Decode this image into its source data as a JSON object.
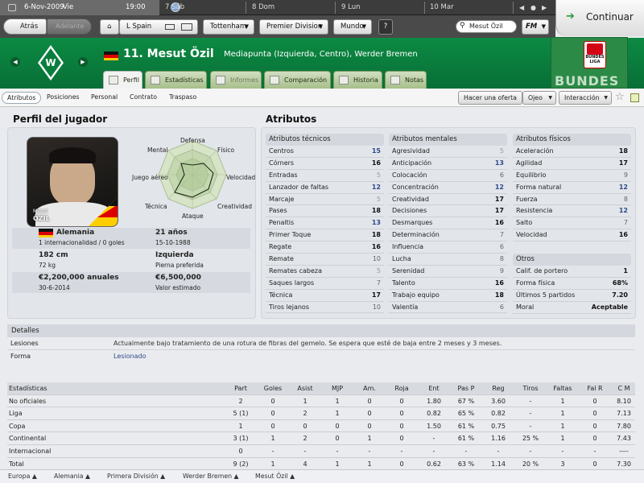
{
  "datebar": {
    "current": "6-Nov-2009",
    "current_day": "Vie",
    "time": "19:00",
    "days": [
      {
        "num": "7",
        "name": "Sáb"
      },
      {
        "num": "8",
        "name": "Dom"
      },
      {
        "num": "9",
        "name": "Lun"
      },
      {
        "num": "10",
        "name": "Mar"
      }
    ]
  },
  "toolbar": {
    "back": "Atrás",
    "forward": "Adelante",
    "nation": "L Spain",
    "club": "Tottenham",
    "league": "Premier Division",
    "world": "Mundo",
    "help": "?",
    "search_value": "Mesut Özil",
    "fm": "FM",
    "continue": "Continuar"
  },
  "player": {
    "number_name": "11. Mesut Özil",
    "position_club": "Mediapunta (Izquierda, Centro), Werder Bremen",
    "league_badge": "BUNDES LIGA",
    "league_banner": "BUNDES"
  },
  "tabs": [
    "Perfil",
    "Estadísticas",
    "Informes",
    "Comparación",
    "Historia",
    "Notas"
  ],
  "subtabs": [
    "Atributos",
    "Posiciones",
    "Personal",
    "Contrato",
    "Traspaso"
  ],
  "actions": {
    "offer": "Hacer una oferta",
    "scout": "Ojeo",
    "interaction": "Interacción"
  },
  "profile": {
    "title": "Perfil del jugador",
    "photo_name_top": "Mesut",
    "photo_name": "ÖZIL",
    "radar_labels": [
      "Defensa",
      "Físico",
      "Velocidad",
      "Creatividad",
      "Ataque",
      "Técnica",
      "Juego aéreo",
      "Mental"
    ],
    "nationality": "Alemania",
    "caps": "1 internacionalidad / 0 goles",
    "age": "21 años",
    "dob": "15-10-1988",
    "height": "182 cm",
    "weight": "72 kg",
    "foot": "Izquierda",
    "foot_label": "Pierna preferida",
    "wage": "€2,200,000 anuales",
    "contract_end": "30-6-2014",
    "value": "€6,500,000",
    "value_label": "Valor estimado"
  },
  "attributes": {
    "title": "Atributos",
    "technical": {
      "title": "Atributos técnicos",
      "rows": [
        {
          "name": "Centros",
          "value": "15",
          "tier": "good"
        },
        {
          "name": "Córners",
          "value": "16",
          "tier": "hi"
        },
        {
          "name": "Entradas",
          "value": "5",
          "tier": "lo"
        },
        {
          "name": "Lanzador de faltas",
          "value": "12",
          "tier": "good"
        },
        {
          "name": "Marcaje",
          "value": "5",
          "tier": "lo"
        },
        {
          "name": "Pases",
          "value": "18",
          "tier": "hi"
        },
        {
          "name": "Penaltis",
          "value": "13",
          "tier": "good"
        },
        {
          "name": "Primer Toque",
          "value": "18",
          "tier": "hi"
        },
        {
          "name": "Regate",
          "value": "16",
          "tier": "hi"
        },
        {
          "name": "Remate",
          "value": "10",
          "tier": "mid"
        },
        {
          "name": "Remates cabeza",
          "value": "5",
          "tier": "lo"
        },
        {
          "name": "Saques largos",
          "value": "7",
          "tier": "mid"
        },
        {
          "name": "Técnica",
          "value": "17",
          "tier": "hi"
        },
        {
          "name": "Tiros lejanos",
          "value": "10",
          "tier": "mid"
        }
      ]
    },
    "mental": {
      "title": "Atributos mentales",
      "rows": [
        {
          "name": "Agresividad",
          "value": "5",
          "tier": "lo"
        },
        {
          "name": "Anticipación",
          "value": "13",
          "tier": "good"
        },
        {
          "name": "Colocación",
          "value": "6",
          "tier": "mid"
        },
        {
          "name": "Concentración",
          "value": "12",
          "tier": "good"
        },
        {
          "name": "Creatividad",
          "value": "17",
          "tier": "hi"
        },
        {
          "name": "Decisiones",
          "value": "17",
          "tier": "hi"
        },
        {
          "name": "Desmarques",
          "value": "16",
          "tier": "hi"
        },
        {
          "name": "Determinación",
          "value": "7",
          "tier": "mid"
        },
        {
          "name": "Influencia",
          "value": "6",
          "tier": "mid"
        },
        {
          "name": "Lucha",
          "value": "8",
          "tier": "mid"
        },
        {
          "name": "Serenidad",
          "value": "9",
          "tier": "mid"
        },
        {
          "name": "Talento",
          "value": "16",
          "tier": "hi"
        },
        {
          "name": "Trabajo equipo",
          "value": "18",
          "tier": "hi"
        },
        {
          "name": "Valentía",
          "value": "6",
          "tier": "mid"
        }
      ]
    },
    "physical": {
      "title": "Atributos físicos",
      "rows": [
        {
          "name": "Aceleración",
          "value": "18",
          "tier": "hi"
        },
        {
          "name": "Agilidad",
          "value": "17",
          "tier": "hi"
        },
        {
          "name": "Equilibrio",
          "value": "9",
          "tier": "mid"
        },
        {
          "name": "Forma natural",
          "value": "12",
          "tier": "good"
        },
        {
          "name": "Fuerza",
          "value": "8",
          "tier": "mid"
        },
        {
          "name": "Resistencia",
          "value": "12",
          "tier": "good"
        },
        {
          "name": "Salto",
          "value": "7",
          "tier": "mid"
        },
        {
          "name": "Velocidad",
          "value": "16",
          "tier": "hi"
        }
      ]
    },
    "other": {
      "title": "Otros",
      "rows": [
        {
          "name": "Calif. de portero",
          "value": "1"
        },
        {
          "name": "Forma física",
          "value": "68%"
        },
        {
          "name": "Últimos 5 partidos",
          "value": "7.20"
        },
        {
          "name": "Moral",
          "value": "Aceptable"
        }
      ]
    }
  },
  "details": {
    "title": "Detalles",
    "injury_label": "Lesiones",
    "injury_text": "Actualmente bajo tratamiento de una rotura de fibras del gemelo. Se espera que esté de baja entre 2 meses y 3 meses.",
    "form_label": "Forma",
    "form_text": "Lesionado"
  },
  "stats": {
    "headers": [
      "Estadísticas",
      "Part",
      "Goles",
      "Asist",
      "MJP",
      "Am.",
      "Roja",
      "Ent",
      "Pas P",
      "Reg",
      "Tiros",
      "Faltas",
      "Fal R",
      "C M"
    ],
    "rows": [
      [
        "No oficiales",
        "2",
        "0",
        "1",
        "1",
        "0",
        "0",
        "1.80",
        "67 %",
        "3.60",
        "-",
        "1",
        "0",
        "8.10"
      ],
      [
        "Liga",
        "5 (1)",
        "0",
        "2",
        "1",
        "0",
        "0",
        "0.82",
        "65 %",
        "0.82",
        "-",
        "1",
        "0",
        "7.13"
      ],
      [
        "Copa",
        "1",
        "0",
        "0",
        "0",
        "0",
        "0",
        "1.50",
        "61 %",
        "0.75",
        "-",
        "1",
        "0",
        "7.80"
      ],
      [
        "Continental",
        "3 (1)",
        "1",
        "2",
        "0",
        "1",
        "0",
        "-",
        "61 %",
        "1.16",
        "25 %",
        "1",
        "0",
        "7.43"
      ],
      [
        "Internacional",
        "0",
        "-",
        "-",
        "-",
        "-",
        "-",
        "-",
        "-",
        "-",
        "-",
        "-",
        "-",
        "----"
      ],
      [
        "Total",
        "9 (2)",
        "1",
        "4",
        "1",
        "1",
        "0",
        "0.62",
        "63 %",
        "1.14",
        "20 %",
        "3",
        "0",
        "7.30"
      ]
    ]
  },
  "footer": [
    "Europa",
    "Alemania",
    "Primera División",
    "Werder Bremen",
    "Mesut Özil"
  ],
  "colors": {
    "header_green": "#0a7d3d",
    "accent_blue": "#2e4a8a"
  }
}
